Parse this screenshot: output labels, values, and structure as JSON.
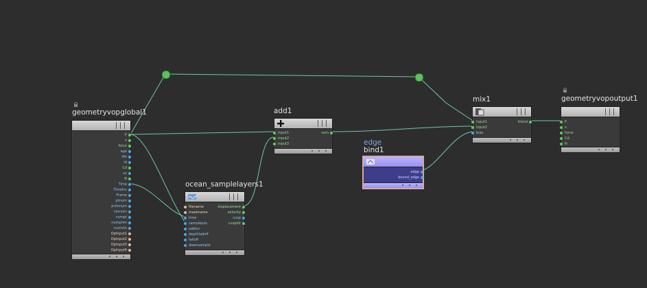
{
  "nodes": {
    "global": {
      "name": "geometryvopglobal1",
      "outputs": [
        "P",
        "v",
        "force",
        "age",
        "life",
        "id",
        "Cd",
        "uv",
        "N",
        "Time",
        "TimeInc",
        "Frame",
        "ptnum",
        "primnum",
        "vtxnum",
        "numpt",
        "numprim",
        "numvtx",
        "OpInput1",
        "OpInput2",
        "OpInput3",
        "OpInput4"
      ]
    },
    "add": {
      "name": "add1",
      "inputs": [
        "input1",
        "input2",
        "input3"
      ],
      "outputs": [
        "sum"
      ]
    },
    "ocean": {
      "name": "ocean_samplelayers1",
      "inputs": [
        "filename",
        "maskname",
        "time",
        "samplepos",
        "aabtur",
        "depthfalloff",
        "falloff",
        "downsample"
      ],
      "outputs": [
        "displacement",
        "velocity",
        "cusp",
        "cuspdir"
      ]
    },
    "bind": {
      "subtitle": "edge",
      "name": "bind1",
      "outputs": [
        "edge",
        "bound_edge"
      ]
    },
    "mix": {
      "name": "mix1",
      "inputs": [
        "input1",
        "input2",
        "bias"
      ],
      "outputs": [
        "blend"
      ]
    },
    "output": {
      "name": "geometryvopoutput1",
      "inputs": [
        "P",
        "v",
        "force",
        "Cd",
        "N"
      ]
    }
  },
  "colors": {
    "background": "#2d2d2d",
    "wire": "#6fc8a8",
    "vector_port": "#5fd05f",
    "float_port": "#4aa8e8",
    "string_port": "#e0b8a0",
    "bind_node": "#9890f0"
  },
  "icons": {
    "add": "plus-icon",
    "ocean": "wave-icon",
    "bind": "bind-icon",
    "mix": "mix-icon"
  }
}
